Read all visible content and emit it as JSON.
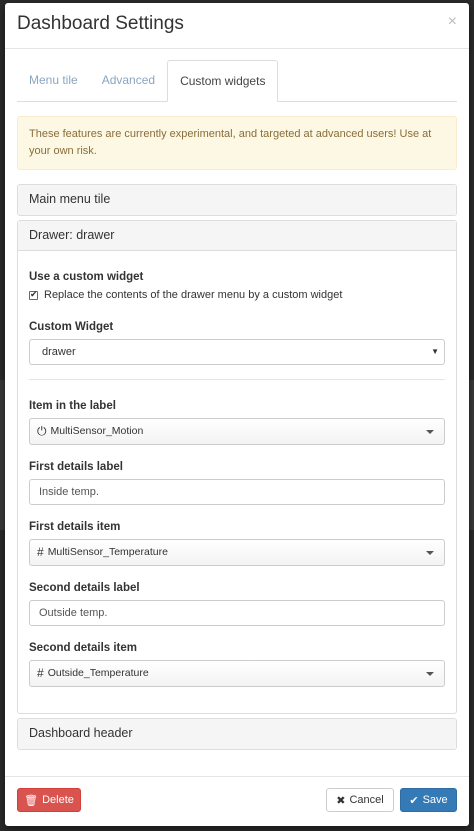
{
  "modal": {
    "title": "Dashboard Settings",
    "close_glyph": "×"
  },
  "tabs": [
    {
      "label": "Menu tile",
      "active": false
    },
    {
      "label": "Advanced",
      "active": false
    },
    {
      "label": "Custom widgets",
      "active": true
    }
  ],
  "alert": {
    "text": "These features are currently experimental, and targeted at advanced users! Use at your own risk."
  },
  "panels": {
    "main_menu_tile": {
      "title": "Main menu tile"
    },
    "drawer": {
      "title": "Drawer: drawer",
      "use_custom_widget_label": "Use a custom widget",
      "checkbox_label": "Replace the contents of the drawer menu by a custom widget",
      "checkbox_checked": true,
      "custom_widget_label": "Custom Widget",
      "custom_widget_value": "drawer",
      "item_in_label": {
        "label": "Item in the label",
        "icon": "power-icon",
        "value": "MultiSensor_Motion"
      },
      "first_details_label": {
        "label": "First details label",
        "value": "Inside temp."
      },
      "first_details_item": {
        "label": "First details item",
        "icon": "hash-icon",
        "value": "MultiSensor_Temperature"
      },
      "second_details_label": {
        "label": "Second details label",
        "value": "Outside temp."
      },
      "second_details_item": {
        "label": "Second details item",
        "icon": "hash-icon",
        "value": "Outside_Temperature"
      }
    },
    "dashboard_header": {
      "title": "Dashboard header"
    }
  },
  "footer": {
    "delete_label": "Delete",
    "cancel_label": "Cancel",
    "save_label": "Save"
  },
  "colors": {
    "delete": "#d9534f",
    "save": "#337ab7",
    "alert_bg": "#fcf8e3",
    "alert_text": "#8a6d3b",
    "tab_inactive": "#8aa6c1"
  }
}
